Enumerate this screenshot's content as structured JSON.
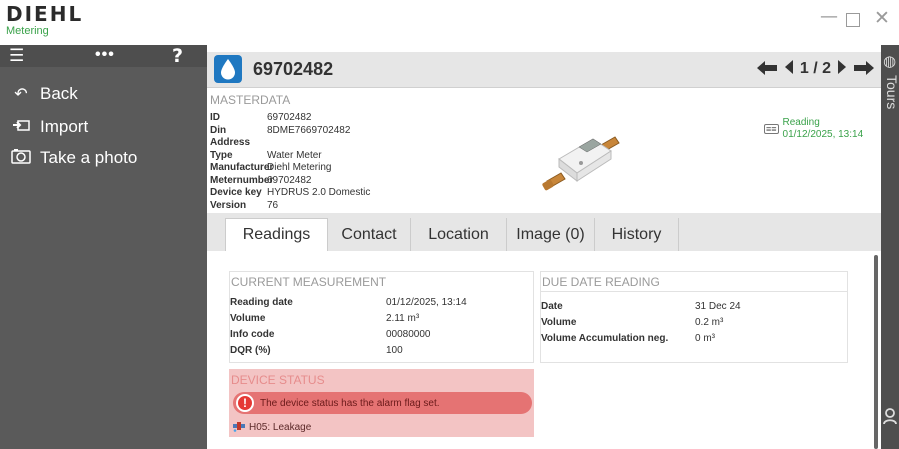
{
  "app": {
    "logo_main": "DIEHL",
    "logo_sub": "Metering"
  },
  "window_controls": {
    "minimize": "—",
    "close": "✕"
  },
  "sidebar": {
    "top_icons": [
      "menu-icon",
      "more-icon",
      "help-icon"
    ],
    "items": [
      {
        "label": "Back",
        "icon": "back-arrow-icon"
      },
      {
        "label": "Import",
        "icon": "import-icon"
      },
      {
        "label": "Take a photo",
        "icon": "camera-icon"
      }
    ]
  },
  "header": {
    "meter_id": "69702482",
    "page": "1 / 2"
  },
  "masterdata": {
    "title": "MASTERDATA",
    "rows": [
      {
        "key": "ID",
        "value": "69702482"
      },
      {
        "key": "Din Address",
        "value": "8DME7669702482"
      },
      {
        "key": "Type",
        "value": "Water Meter"
      },
      {
        "key": "Manufacturer",
        "value": "Diehl Metering"
      },
      {
        "key": "Meternumber",
        "value": "69702482"
      },
      {
        "key": "Device key",
        "value": "HYDRUS 2.0 Domestic"
      },
      {
        "key": "Version",
        "value": "76"
      }
    ],
    "reading_label": "Reading",
    "reading_date": "01/12/2025, 13:14"
  },
  "right_strip": {
    "label": "Tours"
  },
  "tabs": [
    {
      "label": "Readings",
      "active": true
    },
    {
      "label": "Contact",
      "active": false
    },
    {
      "label": "Location",
      "active": false
    },
    {
      "label": "Image (0)",
      "active": false
    },
    {
      "label": "History",
      "active": false
    }
  ],
  "current_measurement": {
    "title": "CURRENT MEASUREMENT",
    "rows": [
      {
        "key": "Reading date",
        "value": "01/12/2025, 13:14"
      },
      {
        "key": "Volume",
        "value": "2.11 m³"
      },
      {
        "key": "Info code",
        "value": "00080000"
      },
      {
        "key": "DQR (%)",
        "value": "100"
      }
    ]
  },
  "due_date_reading": {
    "title": "DUE DATE READING",
    "rows": [
      {
        "key": "Date",
        "value": "31 Dec 24"
      },
      {
        "key": "Volume",
        "value": "0.2 m³"
      },
      {
        "key": "Volume Accumulation neg.",
        "value": "0 m³"
      }
    ]
  },
  "device_status": {
    "title": "DEVICE STATUS",
    "alarm_text": "The device status has the alarm flag set.",
    "alarm_color": "#e57373",
    "leak_text": "H05: Leakage"
  },
  "colors": {
    "brand_green": "#3aa24a",
    "sidebar_bg": "#5a5a5a",
    "water_blue": "#1f78c1",
    "status_bg": "#f3c4c4"
  }
}
